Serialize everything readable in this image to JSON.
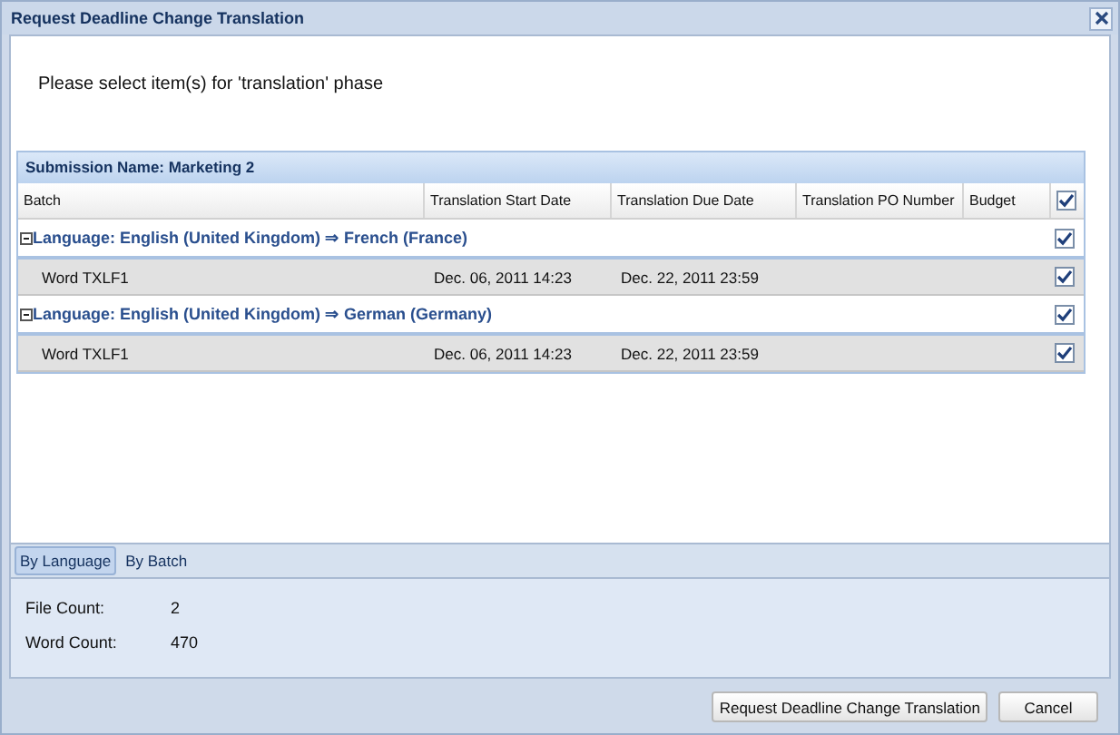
{
  "window": {
    "title": "Request Deadline Change Translation"
  },
  "instruction": "Please select item(s) for 'translation' phase",
  "grid": {
    "submission": "Submission Name: Marketing 2",
    "columns": [
      "Batch",
      "Translation Start Date",
      "Translation Due Date",
      "Translation PO Number",
      "Budget"
    ],
    "all_checked": true,
    "groups": [
      {
        "label": "Language: English (United Kingdom) ⇒ French (France)",
        "expanded": true,
        "checked": true,
        "rows": [
          {
            "cells": [
              "Word TXLF1",
              "Dec. 06, 2011 14:23",
              "Dec. 22, 2011 23:59"
            ],
            "checked": true
          }
        ]
      },
      {
        "label": "Language: English (United Kingdom) ⇒ German (Germany)",
        "expanded": true,
        "checked": true,
        "rows": [
          {
            "cells": [
              "Word TXLF1",
              "Dec. 06, 2011 14:23",
              "Dec. 22, 2011 23:59"
            ],
            "checked": true
          }
        ]
      }
    ]
  },
  "tabs": [
    {
      "label": "By Language",
      "selected": true
    },
    {
      "label": "By Batch",
      "selected": false
    }
  ],
  "stats": [
    {
      "label": "File Count:",
      "value": "2"
    },
    {
      "label": "Word Count:",
      "value": "470"
    }
  ],
  "buttons": [
    "Request Deadline Change Translation",
    "Cancel"
  ]
}
